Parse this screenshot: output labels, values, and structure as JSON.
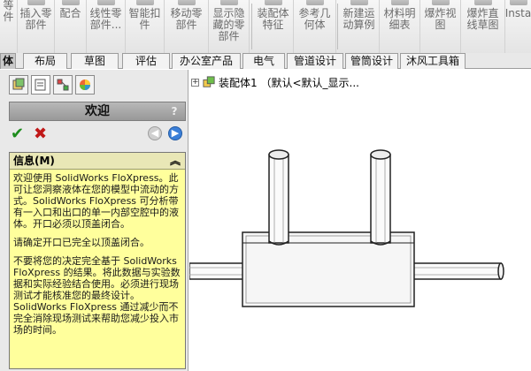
{
  "toolbar": {
    "buttons": [
      {
        "label": "等\n件",
        "icon": "toolbar-icon"
      },
      {
        "label": "插入零\n部件",
        "icon": "insert-components-icon"
      },
      {
        "label": "配合",
        "icon": "mate-icon"
      },
      {
        "label": "线性零\n部件...",
        "icon": "linear-pattern-icon"
      },
      {
        "label": "智能扣\n件",
        "icon": "smart-fasteners-icon"
      },
      {
        "label": "移动零\n部件",
        "icon": "move-component-icon"
      },
      {
        "label": "显示隐\n藏的零\n部件",
        "icon": "show-hidden-icon"
      },
      {
        "label": "装配体\n特征",
        "icon": "assembly-features-icon"
      },
      {
        "label": "参考几\n何体",
        "icon": "reference-geometry-icon"
      },
      {
        "label": "新建运\n动算例",
        "icon": "new-motion-study-icon"
      },
      {
        "label": "材料明\n细表",
        "icon": "bom-icon"
      },
      {
        "label": "爆炸视\n图",
        "icon": "exploded-view-icon"
      },
      {
        "label": "爆炸直\n线草图",
        "icon": "explode-line-sketch-icon"
      },
      {
        "label": "Insta",
        "icon": "instant3d-icon"
      }
    ]
  },
  "tabs": [
    "体",
    "布局",
    "草图",
    "评估",
    "办公室产品",
    "电气",
    "管道设计",
    "管筒设计",
    "沐风工具箱"
  ],
  "panel": {
    "welcome_title": "欢迎",
    "help_glyph": "?",
    "info_title": "信息(M)",
    "info_paragraphs": [
      "欢迎使用 SolidWorks FloXpress。此可让您洞察液体在您的模型中流动的方式。SolidWorks FloXpress 可分析带有一入口和出口的单一内部空腔中的液体。开口必须以顶盖闭合。",
      "请确定开口已完全以顶盖闭合。",
      "不要将您的决定完全基于 SolidWorks FloXpress 的结果。将此数据与实验数据和实际经验结合使用。必须进行现场测试才能核准您的最终设计。SolidWorks FloXpress 通过减少而不完全消除现场测试来帮助您减少投入市场的时间。"
    ]
  },
  "tree": {
    "expand_glyph": "+",
    "node_label": "装配体1 （默认<默认_显示..."
  },
  "colors": {
    "ok": "#1c8c1c",
    "cancel": "#c01818",
    "info_bg": "#ffff9c",
    "forward": "#3b7fd8"
  }
}
